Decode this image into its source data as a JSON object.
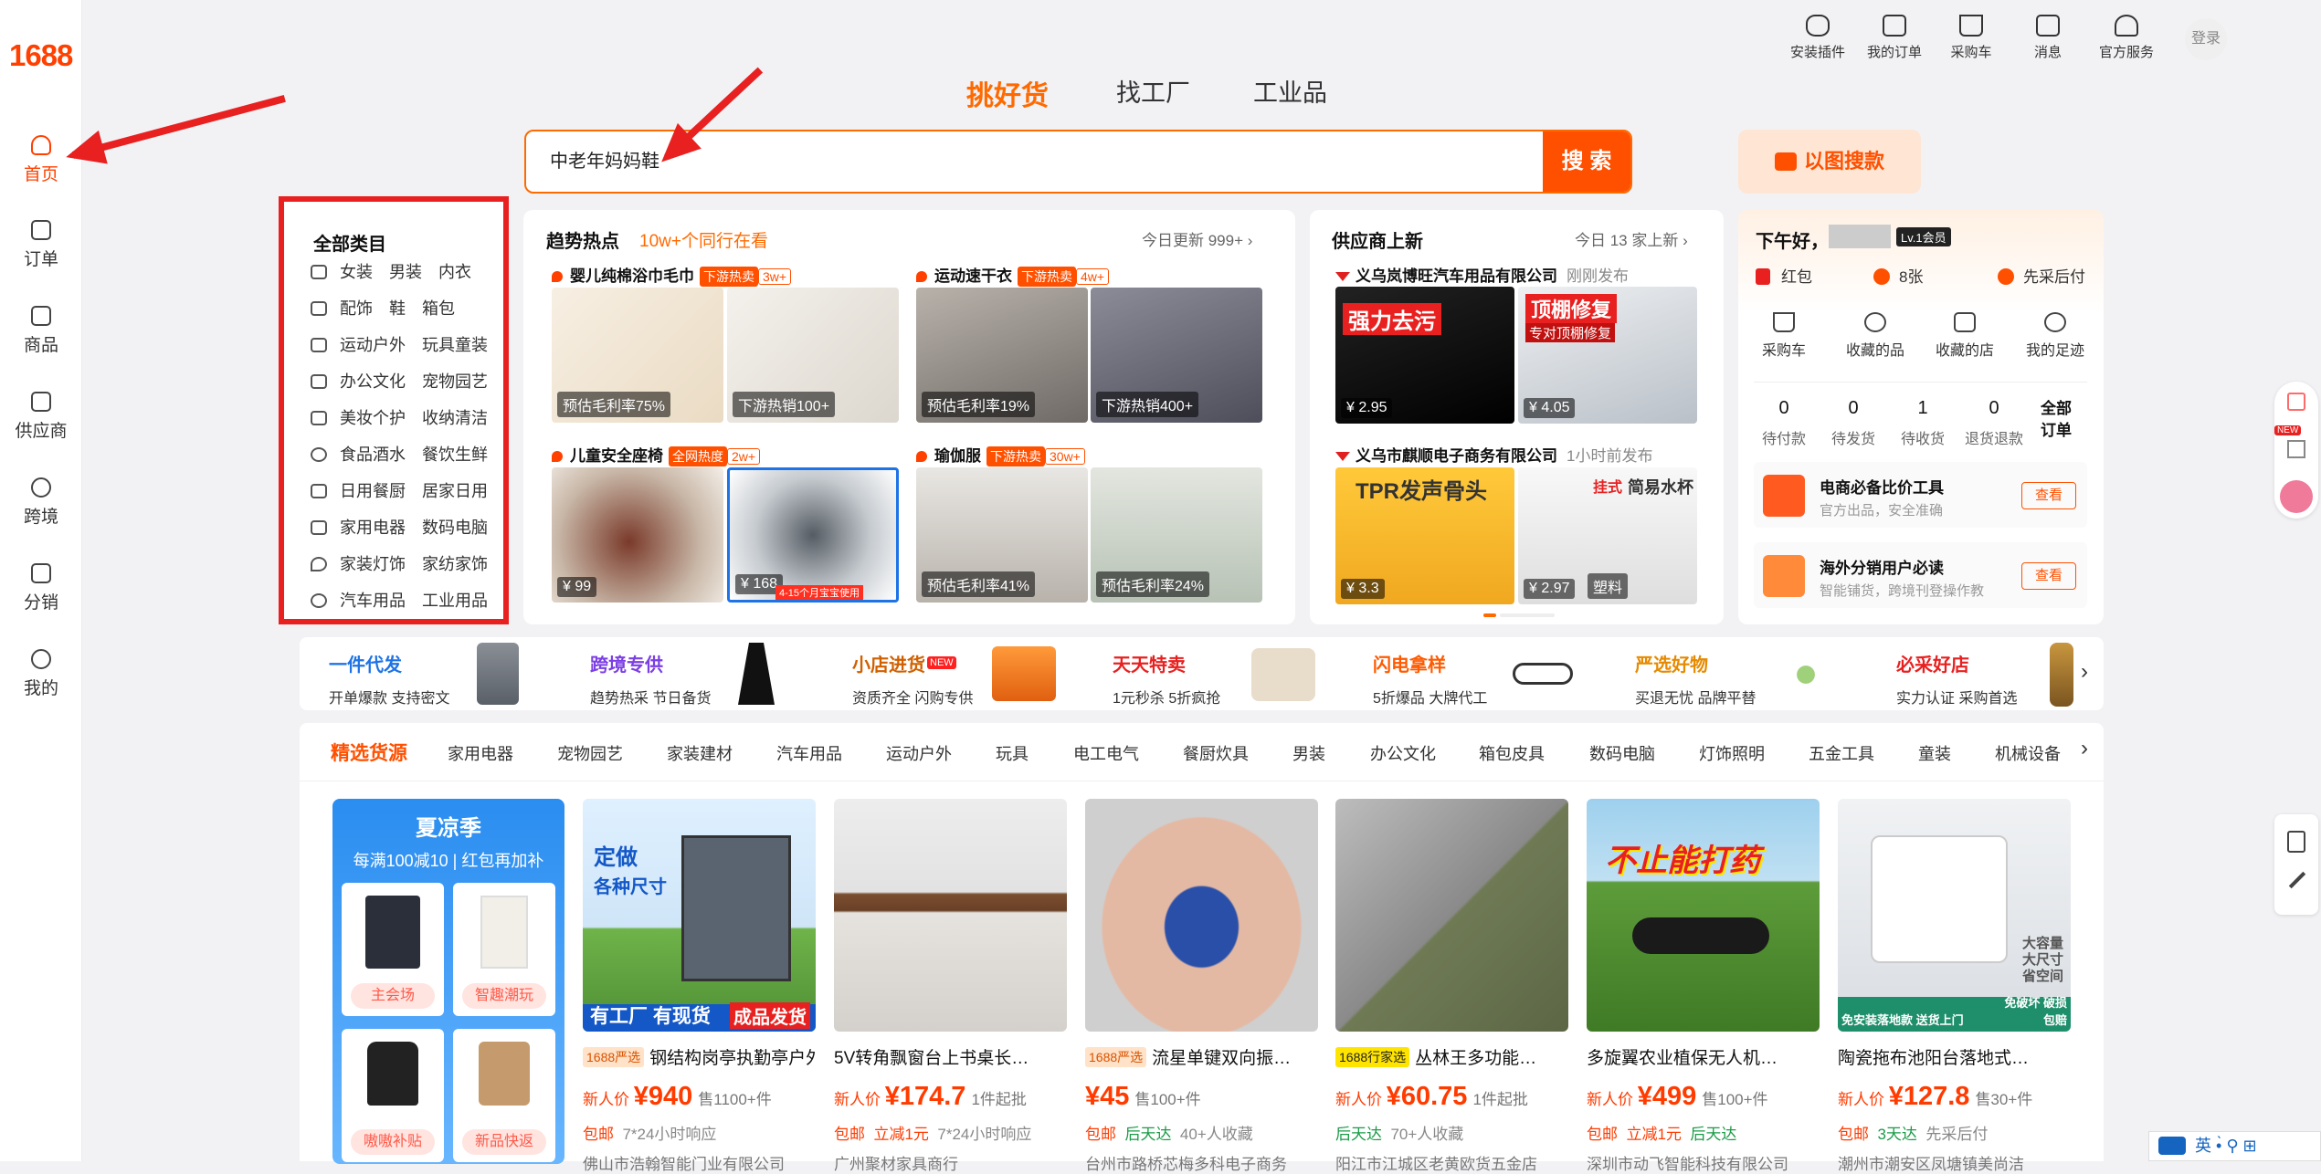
{
  "brand": {
    "logo": "1688",
    "color": "#ff4000"
  },
  "sidebar": {
    "items": [
      {
        "label": "首页",
        "icon": "home-icon",
        "active": true
      },
      {
        "label": "订单",
        "icon": "order-icon"
      },
      {
        "label": "商品",
        "icon": "grid-icon"
      },
      {
        "label": "供应商",
        "icon": "store-icon"
      },
      {
        "label": "跨境",
        "icon": "globe-icon"
      },
      {
        "label": "分销",
        "icon": "share-icon"
      },
      {
        "label": "我的",
        "icon": "user-heart-icon"
      }
    ]
  },
  "topbar": {
    "items": [
      {
        "label": "安装插件",
        "icon": "puzzle-icon"
      },
      {
        "label": "我的订单",
        "icon": "clipboard-icon"
      },
      {
        "label": "采购车",
        "icon": "cart-icon"
      },
      {
        "label": "消息",
        "icon": "message-icon"
      },
      {
        "label": "官方服务",
        "icon": "user-icon"
      }
    ],
    "login": "登录"
  },
  "nav_tabs": [
    {
      "label": "挑好货",
      "active": true
    },
    {
      "label": "找工厂"
    },
    {
      "label": "工业品"
    }
  ],
  "search": {
    "value": "中老年妈妈鞋",
    "button": "搜 索",
    "image_search": "以图搜款"
  },
  "categories": {
    "title": "全部类目",
    "rows": [
      [
        "女装",
        "男装",
        "内衣"
      ],
      [
        "配饰",
        "鞋",
        "箱包"
      ],
      [
        "运动户外",
        "玩具童装"
      ],
      [
        "办公文化",
        "宠物园艺"
      ],
      [
        "美妆个护",
        "收纳清洁"
      ],
      [
        "食品酒水",
        "餐饮生鲜"
      ],
      [
        "日用餐厨",
        "居家日用"
      ],
      [
        "家用电器",
        "数码电脑"
      ],
      [
        "家装灯饰",
        "家纺家饰"
      ],
      [
        "汽车用品",
        "工业用品"
      ]
    ]
  },
  "trending": {
    "title": "趋势热点",
    "subtitle": "10w+个同行在看",
    "meta": "今日更新 999+ ›",
    "topics": [
      {
        "name": "婴儿纯棉浴巾毛巾",
        "hot_label": "下游热卖",
        "hot_count": "3w+",
        "captions": [
          "预估毛利率75%",
          "下游热销100+"
        ]
      },
      {
        "name": "运动速干衣",
        "hot_label": "下游热卖",
        "hot_count": "4w+",
        "captions": [
          "预估毛利率19%",
          "下游热销400+"
        ]
      },
      {
        "name": "儿童安全座椅",
        "hot_label": "全网热度",
        "hot_count": "2w+",
        "captions": [
          "¥ 99",
          "¥ 168"
        ],
        "footnote": "4-15个月宝宝使用"
      },
      {
        "name": "瑜伽服",
        "hot_label": "下游热卖",
        "hot_count": "30w+",
        "captions": [
          "预估毛利率41%",
          "预估毛利率24%"
        ]
      }
    ]
  },
  "suppliers": {
    "title": "供应商上新",
    "meta": "今日 13 家上新 ›",
    "list": [
      {
        "name": "义乌岚博旺汽车用品有限公司",
        "time": "刚刚发布",
        "captions": [
          "¥ 2.95",
          "¥ 4.05"
        ],
        "banners": [
          "强力去污",
          "顶棚修复",
          "专对顶棚修复"
        ]
      },
      {
        "name": "义乌市麒顺电子商务有限公司",
        "time": "1小时前发布",
        "captions": [
          "¥ 3.3",
          "¥ 2.97"
        ],
        "banners": [
          "TPR发声骨头",
          "简易水杯",
          "塑料",
          "挂式"
        ]
      }
    ]
  },
  "user": {
    "greeting": "下午好，",
    "level": "Lv.1会员",
    "perks": [
      "红包",
      "8张",
      "先采后付"
    ],
    "links": [
      "采购车",
      "收藏的品",
      "收藏的店",
      "我的足迹"
    ],
    "orders": [
      {
        "n": "0",
        "l": "待付款"
      },
      {
        "n": "0",
        "l": "待发货"
      },
      {
        "n": "1",
        "l": "待收货"
      },
      {
        "n": "0",
        "l": "退货退款"
      }
    ],
    "all_orders": "全部\n订单",
    "tools": [
      {
        "title": "电商必备比价工具",
        "sub": "官方出品，安全准确",
        "btn": "查看"
      },
      {
        "title": "海外分销用户必读",
        "sub": "智能铺货，跨境刊登操作教",
        "btn": "查看"
      }
    ]
  },
  "promo": [
    {
      "title": "一件代发",
      "sub": "开单爆款 支持密文",
      "color": "#1e73e6"
    },
    {
      "title": "跨境专供",
      "sub": "趋势热采 节日备货",
      "color": "#7b3fe4"
    },
    {
      "title": "小店进货",
      "sub": "资质齐全 闪购专供",
      "color": "#d06000",
      "badge": "NEW"
    },
    {
      "title": "天天特卖",
      "sub": "1元秒杀 5折疯抢",
      "color": "#e82020"
    },
    {
      "title": "闪电拿样",
      "sub": "5折爆品 大牌代工",
      "color": "#ff5a00"
    },
    {
      "title": "严选好物",
      "sub": "买退无忧 品牌平替",
      "color": "#e68a00"
    },
    {
      "title": "必采好店",
      "sub": "实力认证 采购首选",
      "color": "#e82020"
    }
  ],
  "cat_tabs": [
    "精选货源",
    "家用电器",
    "宠物园艺",
    "家装建材",
    "汽车用品",
    "运动户外",
    "玩具",
    "电工电气",
    "餐厨炊具",
    "男装",
    "办公文化",
    "箱包皮具",
    "数码电脑",
    "灯饰照明",
    "五金工具",
    "童装",
    "机械设备"
  ],
  "summer": {
    "title": "夏凉季",
    "sub": "每满100减10 | 红包再加补",
    "cards": [
      "主会场",
      "智趣潮玩",
      "嗷嗷补贴",
      "新品快返"
    ]
  },
  "products": [
    {
      "tag": "1688严选",
      "name": "钢结构岗亭执勤亭户外…",
      "price_label": "新人价",
      "price": "¥940",
      "sold": "售1100+件",
      "extra": [
        [
          "包邮",
          "o"
        ],
        [
          "7*24小时响应",
          "gy"
        ]
      ],
      "seller": "佛山市浩翰智能门业有限公司",
      "banner": [
        "定做",
        "各种尺寸",
        "有工厂 有现货",
        "成品发货"
      ]
    },
    {
      "tag": "",
      "name": "5V转角飘窗台上书桌长…",
      "price_label": "新人价",
      "price": "¥174.7",
      "sold": "1件起批",
      "extra": [
        [
          "包邮",
          "o"
        ],
        [
          "立减1元",
          "o"
        ],
        [
          "7*24小时响应",
          "gy"
        ]
      ],
      "seller": "广州聚材家具商行"
    },
    {
      "tag": "1688严选",
      "name": "流星单键双向振…",
      "price_label": "",
      "price": "¥45",
      "sold": "售100+件",
      "extra": [
        [
          "包邮",
          "o"
        ],
        [
          "后天达",
          "gr"
        ],
        [
          "40+人收藏",
          "gy"
        ]
      ],
      "seller": "台州市路桥芯梅多科电子商务"
    },
    {
      "tag": "1688行家选",
      "name": "丛林王多功能…",
      "price_label": "新人价",
      "price": "¥60.75",
      "sold": "1件起批",
      "extra": [
        [
          "后天达",
          "gr"
        ],
        [
          "70+人收藏",
          "gy"
        ]
      ],
      "seller": "阳江市江城区老黄欧货五金店"
    },
    {
      "tag": "",
      "name": "多旋翼农业植保无人机…",
      "price_label": "新人价",
      "price": "¥499",
      "sold": "售100+件",
      "extra": [
        [
          "包邮",
          "o"
        ],
        [
          "立减1元",
          "o"
        ],
        [
          "后天达",
          "gr"
        ]
      ],
      "seller": "深圳市动飞智能科技有限公司",
      "banner": [
        "不止能打药"
      ]
    },
    {
      "tag": "",
      "name": "陶瓷拖布池阳台落地式…",
      "price_label": "新人价",
      "price": "¥127.8",
      "sold": "售30+件",
      "extra": [
        [
          "包邮",
          "o"
        ],
        [
          "3天达",
          "gr"
        ],
        [
          "先采后付",
          "gy"
        ]
      ],
      "seller": "潮州市潮安区凤塘镇美尚洁",
      "banner": [
        "大容量",
        "大尺寸",
        "省空间",
        "免安装落地款 送货上门",
        "免破坏 破损包赔"
      ]
    }
  ],
  "ime": "英"
}
